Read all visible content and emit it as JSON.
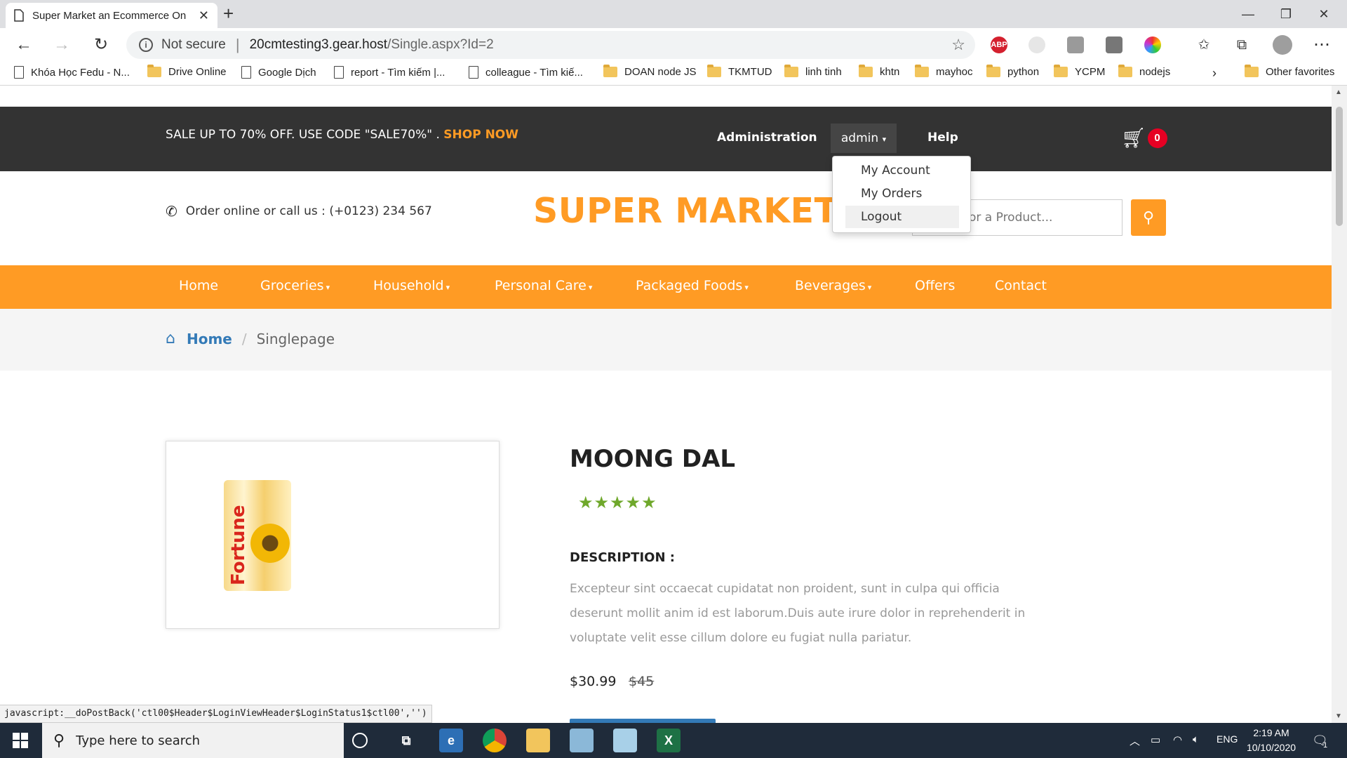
{
  "browser": {
    "tab_title": "Super Market an Ecommerce Online",
    "url_notsecure": "Not secure",
    "url_host": "20cmtesting3.gear.host",
    "url_path": "/Single.aspx?Id=2",
    "new_tab": "+",
    "bookmarks": [
      {
        "label": "Khóa Học Fedu - N...",
        "type": "page"
      },
      {
        "label": "Drive Online",
        "type": "folder"
      },
      {
        "label": "Google Dịch",
        "type": "page"
      },
      {
        "label": "report - Tìm kiếm |...",
        "type": "page"
      },
      {
        "label": "colleague - Tìm kiế...",
        "type": "page"
      },
      {
        "label": "DOAN node JS",
        "type": "folder"
      },
      {
        "label": "TKMTUD",
        "type": "folder"
      },
      {
        "label": "linh tinh",
        "type": "folder"
      },
      {
        "label": "khtn",
        "type": "folder"
      },
      {
        "label": "mayhoc",
        "type": "folder"
      },
      {
        "label": "python",
        "type": "folder"
      },
      {
        "label": "YCPM",
        "type": "folder"
      },
      {
        "label": "nodejs",
        "type": "folder"
      }
    ],
    "other_favorites": "Other favorites",
    "ext_abp": "ABP"
  },
  "topbar": {
    "promo": "SALE UP TO 70% OFF. USE CODE \"SALE70%\" .",
    "shop_now": "SHOP NOW",
    "administration": "Administration",
    "admin": "admin",
    "help": "Help",
    "cart_count": "0"
  },
  "user_menu": {
    "items": [
      "My Account",
      "My Orders",
      "Logout"
    ],
    "highlighted": "Logout"
  },
  "header": {
    "phone": "Order online or call us : (+0123) 234 567",
    "logo": "SUPER MARKET",
    "search_placeholder": "or a Product..."
  },
  "menu": {
    "items": [
      {
        "label": "Home",
        "dropdown": false
      },
      {
        "label": "Groceries",
        "dropdown": true
      },
      {
        "label": "Household",
        "dropdown": true
      },
      {
        "label": "Personal Care",
        "dropdown": true
      },
      {
        "label": "Packaged Foods",
        "dropdown": true
      },
      {
        "label": "Beverages",
        "dropdown": true
      },
      {
        "label": "Offers",
        "dropdown": false
      },
      {
        "label": "Contact",
        "dropdown": false
      }
    ]
  },
  "breadcrumb": {
    "home": "Home",
    "separator": "/",
    "current": "Singlepage"
  },
  "product": {
    "title": "MOONG DAL",
    "rating": 5,
    "rating_max": 5,
    "description_label": "DESCRIPTION :",
    "description": "Excepteur sint occaecat cupidatat non proident, sunt in culpa qui officia deserunt mollit anim id est laborum.Duis aute irure dolor in reprehenderit in voluptate velit esse cillum dolore eu fugiat nulla pariatur.",
    "price": "$30.99",
    "old_price": "$45",
    "image_brand": "Fortune"
  },
  "statusbar": {
    "text": "javascript:__doPostBack('ctl00$Header$LoginViewHeader$LoginStatus1$ctl00','')"
  },
  "taskbar": {
    "search_placeholder": "Type here to search",
    "language": "ENG",
    "time": "2:19 AM",
    "date": "10/10/2020",
    "notifications": "1"
  },
  "colors": {
    "accent": "#ff9b24",
    "topbar": "#333333",
    "link": "#337ab7",
    "star": "#6fa82b",
    "cart_badge": "#e60023"
  }
}
